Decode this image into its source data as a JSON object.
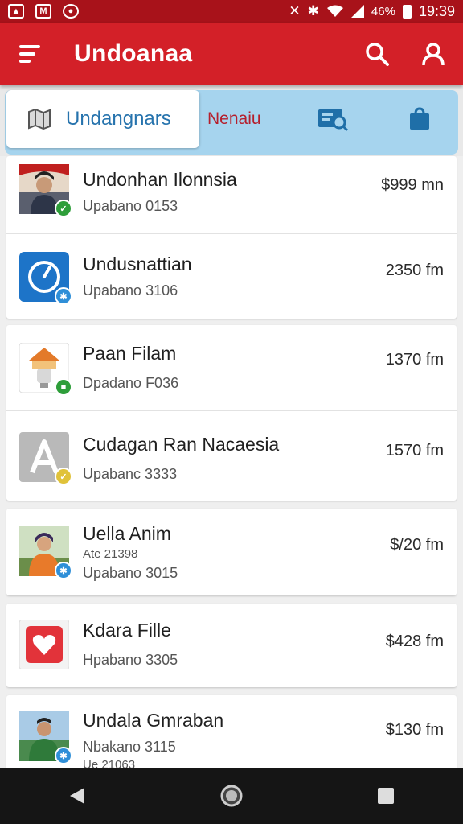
{
  "status_bar": {
    "time": "19:39",
    "battery": "46%",
    "left_icons": [
      "notification-icon",
      "mail-icon",
      "round-icon"
    ],
    "right_icons": [
      "mute-icon",
      "bluetooth-icon",
      "wifi-icon",
      "signal-icon",
      "battery-icon"
    ]
  },
  "app_bar": {
    "title": "Undoanaa",
    "color": "#d32028"
  },
  "tabs": {
    "active_label": "Undangnars",
    "second_label": "Nenaiu"
  },
  "items": [
    {
      "title": "Undonhan Ilonnsia",
      "sub1": "Upabano 0153",
      "sub2": "",
      "price": "$999 mn",
      "thumb": "photo-person",
      "badge": "check",
      "badge_color": "#2e9e3a"
    },
    {
      "title": "Undusnattian",
      "sub1": "Upabano 3106",
      "sub2": "",
      "price": "2350 fm",
      "thumb": "blue-clock",
      "badge": "person",
      "badge_color": "#2f8fd8"
    },
    {
      "title": "Paan Filam",
      "sub1": "Dpadano F036",
      "sub2": "",
      "price": "1370 fm",
      "thumb": "orange-lamp",
      "badge": "lock",
      "badge_color": "#2e9e3a"
    },
    {
      "title": "Cudagan Ran Nacaesia",
      "sub1": "Upabanc 3333",
      "sub2": "",
      "price": "1570 fm",
      "thumb": "grey-a",
      "badge": "check",
      "badge_color": "#e0c23a"
    },
    {
      "title": "Uella Anim",
      "sub1": "Ate 21398",
      "sub2": "Upabano 3015",
      "price": "$/20 fm",
      "thumb": "photo-woman",
      "badge": "person",
      "badge_color": "#2f8fd8"
    },
    {
      "title": "Kdara Fille",
      "sub1": "Hpabano 3305",
      "sub2": "",
      "price": "$428 fm",
      "thumb": "red-heart",
      "badge": "",
      "badge_color": ""
    },
    {
      "title": "Undala Gmraban",
      "sub1": "Nbakano 3115",
      "sub2": "Ue 21063",
      "price": "$130 fm",
      "thumb": "photo-man",
      "badge": "person",
      "badge_color": "#2f8fd8"
    }
  ]
}
